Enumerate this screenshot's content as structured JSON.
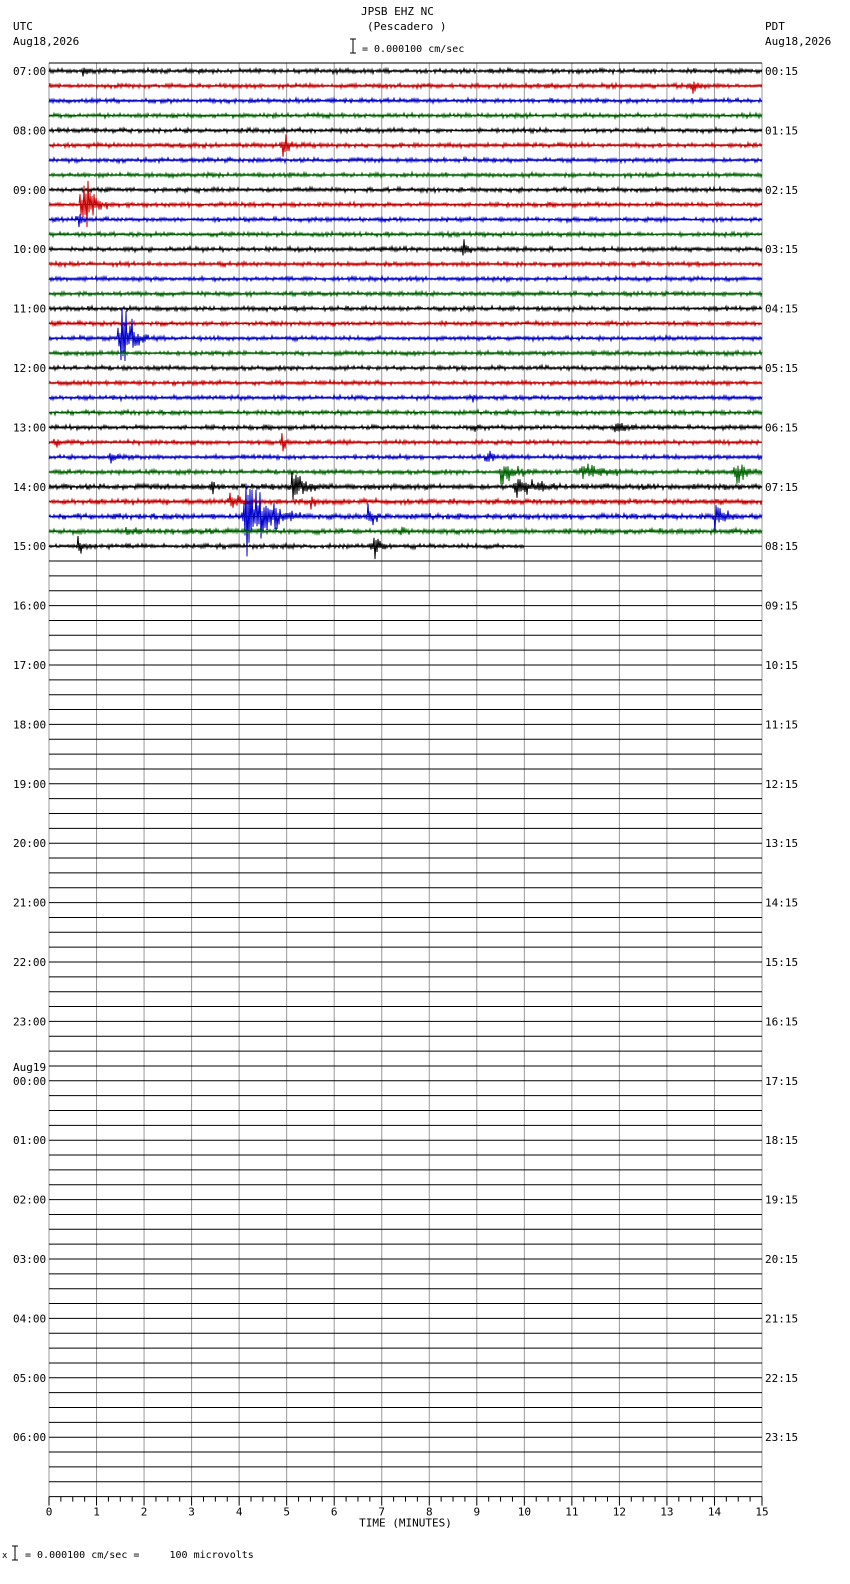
{
  "header": {
    "station": "JPSB EHZ NC",
    "location": "(Pescadero )",
    "scale_text": "= 0.000100 cm/sec",
    "left_tz": "UTC",
    "left_date": "Aug18,2026",
    "right_tz": "PDT",
    "right_date": "Aug18,2026"
  },
  "footer": {
    "scale_text": "= 0.000100 cm/sec =     100 microvolts"
  },
  "chart_data": {
    "type": "line",
    "title": "JPSB EHZ NC (Pescadero )",
    "xlabel": "TIME (MINUTES)",
    "xlim": [
      0,
      15
    ],
    "x_ticks": [
      "0",
      "1",
      "2",
      "3",
      "4",
      "5",
      "6",
      "7",
      "8",
      "9",
      "10",
      "11",
      "12",
      "13",
      "14",
      "15"
    ],
    "rows_per_hour": 4,
    "trace_colors": [
      "#000000",
      "#cc0000",
      "#0000cc",
      "#006600"
    ],
    "left_hour_labels": [
      "07:00",
      "08:00",
      "09:00",
      "10:00",
      "11:00",
      "12:00",
      "13:00",
      "14:00",
      "15:00",
      "16:00",
      "17:00",
      "18:00",
      "19:00",
      "20:00",
      "21:00",
      "22:00",
      "23:00",
      "00:00",
      "01:00",
      "02:00",
      "03:00",
      "04:00",
      "05:00",
      "06:00"
    ],
    "date_change": {
      "hour_index": 17,
      "label": "Aug19"
    },
    "right_hour_labels": [
      "00:15",
      "01:15",
      "02:15",
      "03:15",
      "04:15",
      "05:15",
      "06:15",
      "07:15",
      "08:15",
      "09:15",
      "10:15",
      "11:15",
      "12:15",
      "13:15",
      "14:15",
      "15:15",
      "16:15",
      "17:15",
      "18:15",
      "19:15",
      "20:15",
      "21:15",
      "22:15",
      "23:15"
    ],
    "recorded_traces": 33,
    "last_trace_end_minute": 10.0,
    "noise_amplitude_by_trace": [
      2,
      2,
      2,
      2,
      2,
      2,
      2,
      2,
      2,
      2,
      2,
      2,
      2,
      2,
      2,
      2,
      2,
      2,
      2,
      2,
      2,
      2,
      2,
      2,
      2,
      2,
      2,
      2,
      2.5,
      2.5,
      2.5,
      2.5,
      2
    ],
    "events": [
      {
        "trace": 0,
        "minute": 0.7,
        "amp": 7,
        "dur": 0.3
      },
      {
        "trace": 1,
        "minute": 13.5,
        "amp": 12,
        "dur": 0.3
      },
      {
        "trace": 5,
        "minute": 4.9,
        "amp": 14,
        "dur": 0.4
      },
      {
        "trace": 9,
        "minute": 0.7,
        "amp": 30,
        "dur": 0.6
      },
      {
        "trace": 10,
        "minute": 0.6,
        "amp": 10,
        "dur": 0.3
      },
      {
        "trace": 12,
        "minute": 8.7,
        "amp": 14,
        "dur": 0.3
      },
      {
        "trace": 18,
        "minute": 1.5,
        "amp": 40,
        "dur": 0.6
      },
      {
        "trace": 22,
        "minute": 8.9,
        "amp": 6,
        "dur": 0.3
      },
      {
        "trace": 24,
        "minute": 8.9,
        "amp": 6,
        "dur": 0.3
      },
      {
        "trace": 24,
        "minute": 11.9,
        "amp": 12,
        "dur": 0.6
      },
      {
        "trace": 25,
        "minute": 0.1,
        "amp": 8,
        "dur": 0.3
      },
      {
        "trace": 25,
        "minute": 4.9,
        "amp": 8,
        "dur": 0.3
      },
      {
        "trace": 26,
        "minute": 1.3,
        "amp": 10,
        "dur": 0.3
      },
      {
        "trace": 26,
        "minute": 9.2,
        "amp": 12,
        "dur": 0.4
      },
      {
        "trace": 27,
        "minute": 9.5,
        "amp": 10,
        "dur": 1.2
      },
      {
        "trace": 27,
        "minute": 11.2,
        "amp": 9,
        "dur": 1.8
      },
      {
        "trace": 27,
        "minute": 14.4,
        "amp": 16,
        "dur": 0.7
      },
      {
        "trace": 28,
        "minute": 3.4,
        "amp": 9,
        "dur": 0.3
      },
      {
        "trace": 28,
        "minute": 5.1,
        "amp": 20,
        "dur": 0.8
      },
      {
        "trace": 28,
        "minute": 9.8,
        "amp": 12,
        "dur": 1.5
      },
      {
        "trace": 29,
        "minute": 3.8,
        "amp": 10,
        "dur": 0.6
      },
      {
        "trace": 29,
        "minute": 5.5,
        "amp": 8,
        "dur": 0.5
      },
      {
        "trace": 30,
        "minute": 4.1,
        "amp": 40,
        "dur": 1.2
      },
      {
        "trace": 30,
        "minute": 6.7,
        "amp": 14,
        "dur": 0.4
      },
      {
        "trace": 30,
        "minute": 14.0,
        "amp": 14,
        "dur": 0.6
      },
      {
        "trace": 31,
        "minute": 1.6,
        "amp": 9,
        "dur": 0.6
      },
      {
        "trace": 31,
        "minute": 7.4,
        "amp": 6,
        "dur": 0.3
      },
      {
        "trace": 32,
        "minute": 0.6,
        "amp": 8,
        "dur": 0.4
      },
      {
        "trace": 32,
        "minute": 6.8,
        "amp": 16,
        "dur": 0.4
      }
    ]
  }
}
